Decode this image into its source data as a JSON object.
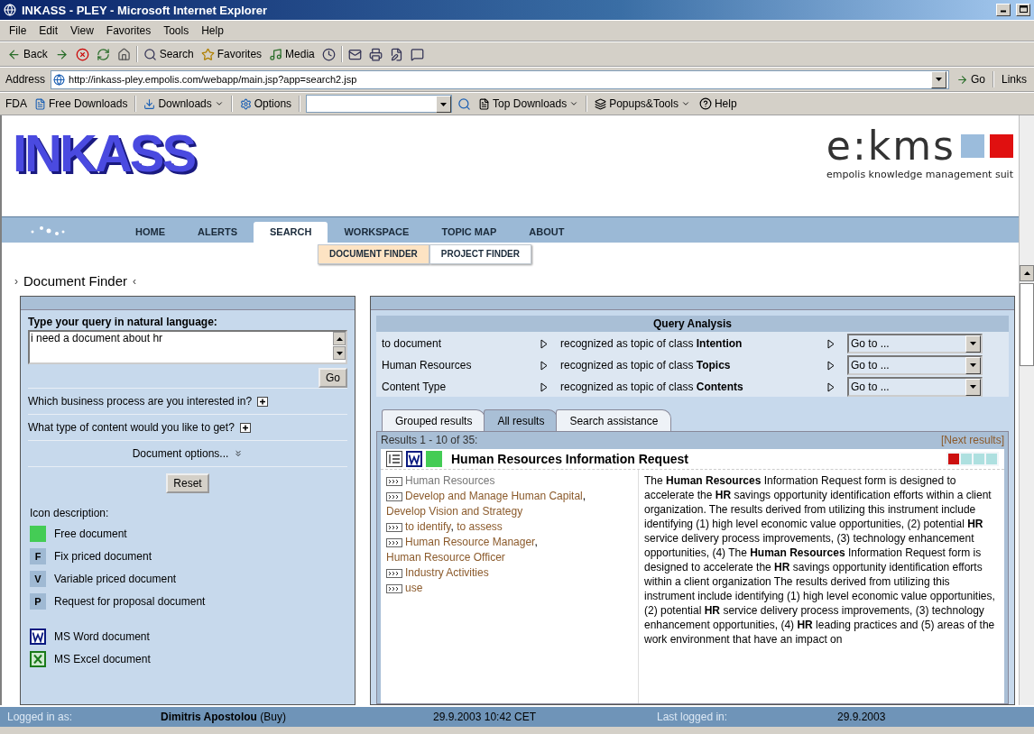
{
  "window": {
    "title": "INKASS - PLEY - Microsoft Internet Explorer"
  },
  "menu": [
    "File",
    "Edit",
    "View",
    "Favorites",
    "Tools",
    "Help"
  ],
  "toolbar": [
    {
      "kind": "back",
      "label": "Back"
    },
    {
      "kind": "forward"
    },
    {
      "kind": "stop"
    },
    {
      "kind": "refresh"
    },
    {
      "kind": "home"
    },
    {
      "kind": "search",
      "label": "Search"
    },
    {
      "kind": "favorites",
      "label": "Favorites"
    },
    {
      "kind": "media",
      "label": "Media"
    },
    {
      "kind": "history"
    },
    {
      "kind": "mail"
    },
    {
      "kind": "print"
    },
    {
      "kind": "edit"
    },
    {
      "kind": "discuss"
    }
  ],
  "address": {
    "label": "Address",
    "url": "http://inkass-pley.empolis.com/webapp/main.jsp?app=search2.jsp",
    "go": "Go",
    "links": "Links"
  },
  "extra_bar": {
    "brand": "FDA",
    "items": [
      {
        "kind": "free",
        "label": "Free Downloads"
      },
      {
        "kind": "downloads",
        "label": "Downloads"
      },
      {
        "kind": "options",
        "label": "Options"
      }
    ],
    "top": "Top Downloads",
    "popups": "Popups&Tools",
    "help": "Help"
  },
  "header": {
    "logo": "INKASS",
    "brand": "e:kms",
    "tagline": "empolis knowledge management suit"
  },
  "nav": [
    {
      "label": "HOME",
      "selected": false
    },
    {
      "label": "ALERTS",
      "selected": false
    },
    {
      "label": "SEARCH",
      "selected": true
    },
    {
      "label": "WORKSPACE",
      "selected": false
    },
    {
      "label": "TOPIC MAP",
      "selected": false
    },
    {
      "label": "ABOUT",
      "selected": false
    }
  ],
  "subnav": [
    {
      "label": "DOCUMENT FINDER",
      "selected": true
    },
    {
      "label": "PROJECT FINDER",
      "selected": false
    }
  ],
  "page_title": {
    "before": "›",
    "text": "Document Finder",
    "after": "‹"
  },
  "query": {
    "label": "Type your query in natural language:",
    "value": "i need a document about hr",
    "go": "Go"
  },
  "questions": [
    {
      "text": "Which business process are you interested in?",
      "expanded": false
    },
    {
      "text": "What type of content would you like to get?",
      "expanded": false
    }
  ],
  "document_options": "Document options...",
  "reset": "Reset",
  "legend": {
    "title": "Icon description:",
    "items": [
      {
        "kind": "free",
        "label": "Free document"
      },
      {
        "kind": "letter",
        "badge": "F",
        "label": "Fix priced document"
      },
      {
        "kind": "letter",
        "badge": "V",
        "label": "Variable priced document"
      },
      {
        "kind": "letter",
        "badge": "P",
        "label": "Request for proposal document"
      },
      {
        "kind": "word",
        "label": "MS Word document"
      },
      {
        "kind": "excel",
        "label": "MS Excel document"
      }
    ]
  },
  "analysis": {
    "title": "Query Analysis",
    "rows": [
      {
        "term": "to document",
        "description": "recognized as topic of class **Intention**",
        "select": "Go to ..."
      },
      {
        "term": "Human Resources",
        "description": "recognized as topic of class **Topics**",
        "select": "Go to ..."
      },
      {
        "term": "Content Type",
        "description": "recognized as topic of class **Contents**",
        "select": "Go to ..."
      }
    ]
  },
  "tabs": [
    {
      "label": "Grouped results",
      "selected": false
    },
    {
      "label": "All results",
      "selected": true
    },
    {
      "label": "Search assistance",
      "selected": false
    }
  ],
  "results": {
    "count": "Results 1 - 10 of 35:",
    "next": "[Next results]",
    "items": [
      {
        "title": "Human Resources Information Request",
        "stars": 1,
        "separator": ",",
        "topics": [
          {
            "kind": "plain",
            "links": [
              "Human Resources"
            ]
          },
          {
            "kind": "link",
            "links": [
              "Develop and Manage Human Capital",
              "Develop Vision and Strategy"
            ]
          },
          {
            "kind": "link",
            "links": [
              "to identify",
              "to assess"
            ]
          },
          {
            "kind": "link",
            "links": [
              "Human Resource Manager",
              "Human Resource Officer"
            ]
          },
          {
            "kind": "link",
            "links": [
              "Industry Activities"
            ]
          },
          {
            "kind": "link",
            "links": [
              "use"
            ]
          }
        ],
        "description": "The **Human Resources** Information Request form is designed to accelerate the **HR** savings opportunity identification efforts within a client organization. The results derived from utilizing this instrument include identifying (1) high level economic value opportunities, (2) potential **HR** service delivery process improvements, (3) technology enhancement opportunities, (4) The **Human Resources** Information Request form is designed to accelerate the **HR** savings opportunity identification efforts within a client organization The results derived from utilizing this instrument include identifying (1) high level economic value opportunities, (2) potential **HR** service delivery process improvements, (3) technology enhancement opportunities, (4) **HR** leading practices and (5) areas of the work environment that have an impact on"
      }
    ]
  },
  "status": {
    "logged_label": "Logged in as:",
    "user": "Dimitris Apostolou",
    "role": "(Buy)",
    "time": "29.9.2003 10:42 CET",
    "last_label": "Last logged in:",
    "last": "29.9.2003"
  }
}
